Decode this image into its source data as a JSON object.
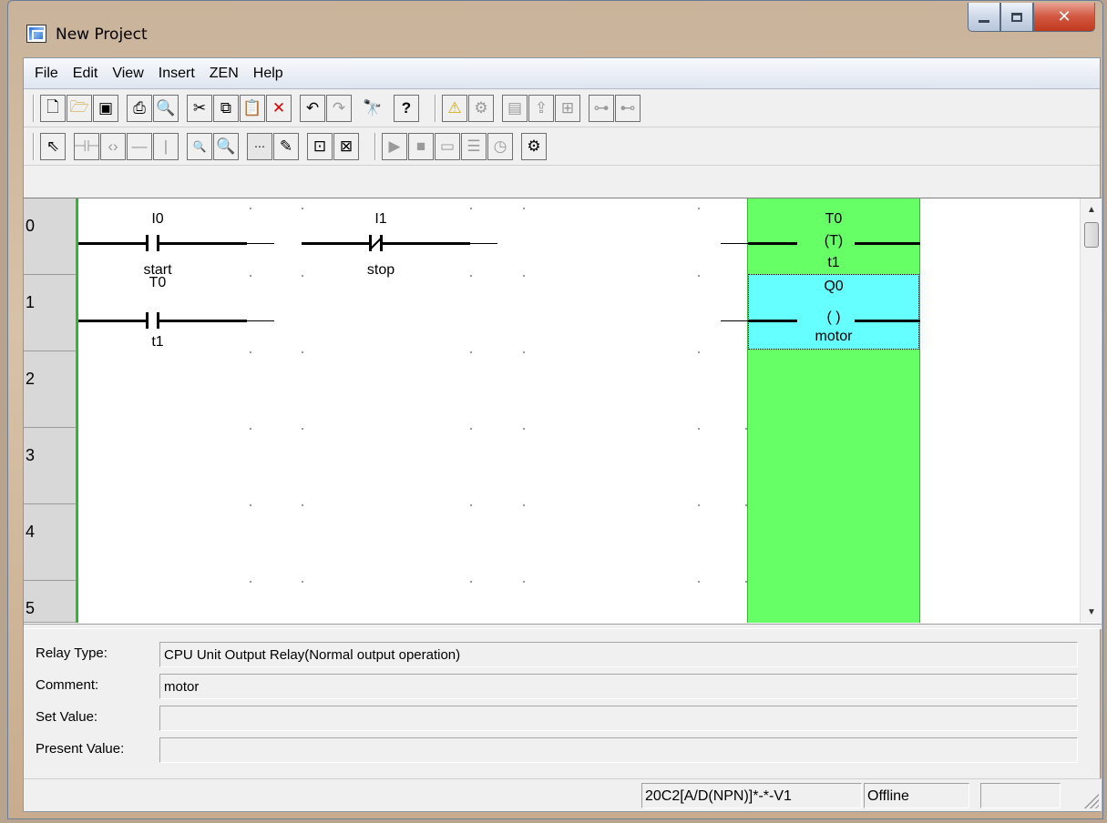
{
  "window": {
    "title": "New Project"
  },
  "menu": [
    "File",
    "Edit",
    "View",
    "Insert",
    "ZEN",
    "Help"
  ],
  "toolbar1": {
    "icons": [
      "new-file-icon",
      "open-folder-icon",
      "save-icon",
      "print-icon",
      "print-preview-icon",
      "cut-icon",
      "copy-icon",
      "paste-icon",
      "delete-icon",
      "undo-icon",
      "redo-icon",
      "find-icon",
      "help-icon",
      "warning-icon",
      "transfer-icon",
      "monitor-icon",
      "upload-icon",
      "compare-icon",
      "connect-icon",
      "disconnect-icon"
    ]
  },
  "toolbar2": {
    "icons": [
      "pointer-icon",
      "contact-icon",
      "coil-icon",
      "hline-icon",
      "vline-icon",
      "zoom-out-icon",
      "zoom-in-icon",
      "grid-icon",
      "comment-icon",
      "ladder-view-icon",
      "list-view-icon",
      "run-icon",
      "stop-icon",
      "monitor-panel-icon",
      "io-list-icon",
      "timer-icon",
      "settings-icon"
    ]
  },
  "ladder": {
    "rows": [
      "0",
      "1",
      "2",
      "3",
      "4",
      "5"
    ],
    "rung0": {
      "c1_addr": "I0",
      "c1_comment": "start",
      "c2_addr": "I1",
      "c2_comment": "stop",
      "coil_addr": "T0",
      "coil_symbol": "(T)",
      "coil_comment": "t1"
    },
    "rung1": {
      "c1_addr": "T0",
      "c1_comment": "t1",
      "coil_addr": "Q0",
      "coil_symbol": "( )",
      "coil_comment": "motor"
    }
  },
  "properties": {
    "relay_type_label": "Relay Type:",
    "relay_type_value": "CPU Unit Output Relay(Normal output operation)",
    "comment_label": "Comment:",
    "comment_value": "motor",
    "set_value_label": "Set Value:",
    "set_value_value": "",
    "present_value_label": "Present Value:",
    "present_value_value": ""
  },
  "status": {
    "model": "20C2[A/D(NPN)]*-*-V1",
    "mode": "Offline",
    "extra": ""
  },
  "colors": {
    "output_column": "#66ff66",
    "selected_cell": "#66ffff",
    "left_rail": "#2db52d"
  }
}
